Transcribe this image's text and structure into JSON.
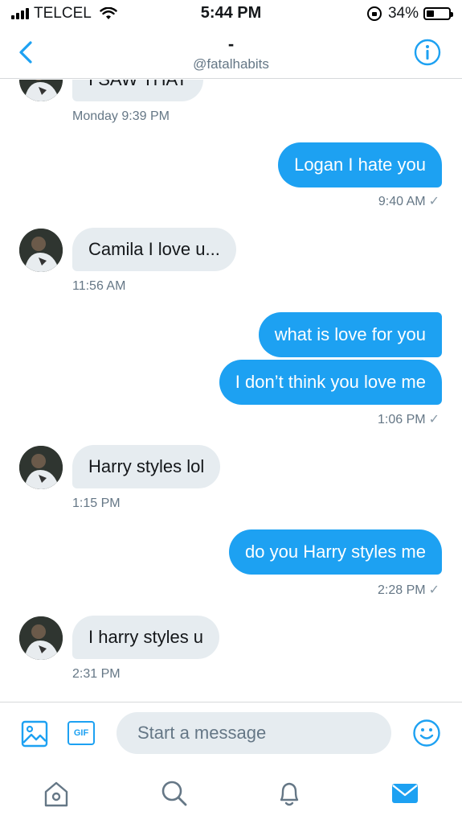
{
  "status_bar": {
    "carrier": "TELCEL",
    "time": "5:44 PM",
    "battery": "34%",
    "battery_level": 0.34
  },
  "header": {
    "title": "-",
    "handle": "@fatalhabits"
  },
  "messages": [
    {
      "direction": "in",
      "text": "I SAW THAT",
      "time": "Monday 9:39 PM"
    },
    {
      "direction": "out",
      "text": "Logan I hate you",
      "time": "9:40 AM"
    },
    {
      "direction": "in",
      "text": "Camila I love u...",
      "time": "11:56 AM"
    },
    {
      "direction": "out",
      "text": "what is love for you"
    },
    {
      "direction": "out",
      "text": "I don’t think you love me",
      "time": "1:06 PM"
    },
    {
      "direction": "in",
      "text": "Harry styles lol",
      "time": "1:15 PM"
    },
    {
      "direction": "out",
      "text": "do you Harry styles me",
      "time": "2:28 PM"
    },
    {
      "direction": "in",
      "text": "I harry styles u",
      "time": "2:31 PM"
    }
  ],
  "read_mark": "✓",
  "composer": {
    "placeholder": "Start a message",
    "gif_label": "GIF"
  },
  "icons": {
    "back": "chevron-left-icon",
    "info": "info-icon",
    "image": "image-icon",
    "emoji": "smiley-icon",
    "home": "home-icon",
    "search": "search-icon",
    "notifications": "bell-icon",
    "messages": "envelope-icon"
  },
  "colors": {
    "accent": "#1da1f2",
    "incoming_bubble": "#e6ecf0",
    "secondary_text": "#657786"
  }
}
